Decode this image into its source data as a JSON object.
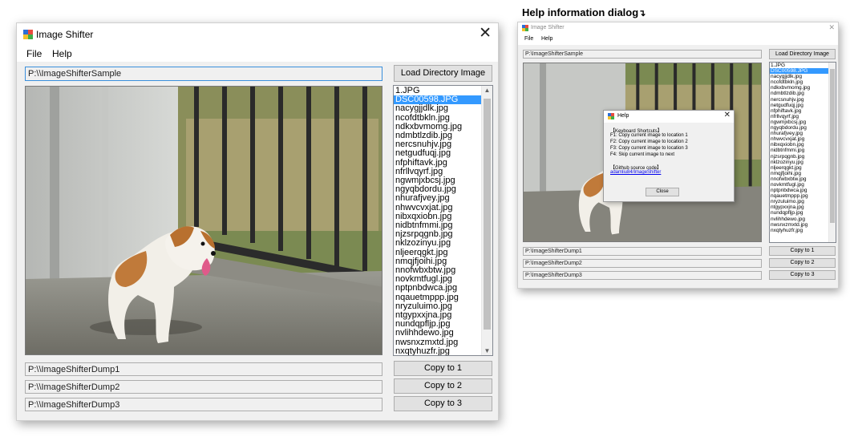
{
  "caption": "Help information dialog",
  "main_window": {
    "title": "Image Shifter",
    "menu": [
      "File",
      "Help"
    ],
    "source_path": "P:\\\\ImageShifterSample",
    "load_button": "Load Directory Image",
    "files": [
      "1.JPG",
      "DSC00598.JPG",
      "nacygjjdlk.jpg",
      "ncofdtbkln.jpg",
      "ndkxbvmomg.jpg",
      "ndmbtlzdib.jpg",
      "nercsnuhjv.jpg",
      "netgudfuqj.jpg",
      "nfphiftavk.jpg",
      "nfrllvqyrf.jpg",
      "ngwmjxbcsj.jpg",
      "ngyqbdordu.jpg",
      "nhurafjvey.jpg",
      "nhwvcvxjat.jpg",
      "nibxqxiobn.jpg",
      "nidbtnfmmi.jpg",
      "njzsrpqgnb.jpg",
      "nklzozinyu.jpg",
      "nljeerqgkt.jpg",
      "nmqjfjoihi.jpg",
      "nnofwbxbtw.jpg",
      "novkmtfugl.jpg",
      "nptpnbdwca.jpg",
      "nqauetmppp.jpg",
      "nryzuluimo.jpg",
      "ntgypxxjna.jpg",
      "nundqpfljp.jpg",
      "nvlihhdewo.jpg",
      "nwsnxzmxtd.jpg",
      "nxqtyhuzfr.jpg"
    ],
    "selected_index": 1,
    "dump_paths": [
      "P:\\\\ImageShifterDump1",
      "P:\\\\ImageShifterDump2",
      "P:\\\\ImageShifterDump3"
    ],
    "copy_buttons": [
      "Copy to 1",
      "Copy to 2",
      "Copy to 3"
    ]
  },
  "small_window": {
    "title": "Image Shifter",
    "menu": [
      "File",
      "Help"
    ],
    "source_path": "P:\\ImageShifterSample",
    "load_button": "Load Directory Image",
    "dump_paths": [
      "P:\\ImageShifterDump1",
      "P:\\ImageShifterDump2",
      "P:\\ImageShifterDump3"
    ],
    "copy_buttons": [
      "Copy to 1",
      "Copy to 2",
      "Copy to 3"
    ]
  },
  "help_dialog": {
    "title": "Help",
    "keyboard_header": "【Keyboard Shortcuts】",
    "shortcuts": [
      "F1: Copy current image to location 1",
      "F2: Copy current image to location 2",
      "F3: Copy current image to location 3",
      "F4: Skip current image to next"
    ],
    "github_header": "【Github source code】",
    "github_link": "adamliu84/ImageShifter",
    "close_button": "Close"
  },
  "colors": {
    "selection": "#3399ff",
    "focus_border": "#3a8fdc",
    "link": "#0000ee"
  },
  "icons": [
    "app-icon",
    "close-icon",
    "scroll-up-icon",
    "scroll-down-icon",
    "arrow-icon"
  ]
}
